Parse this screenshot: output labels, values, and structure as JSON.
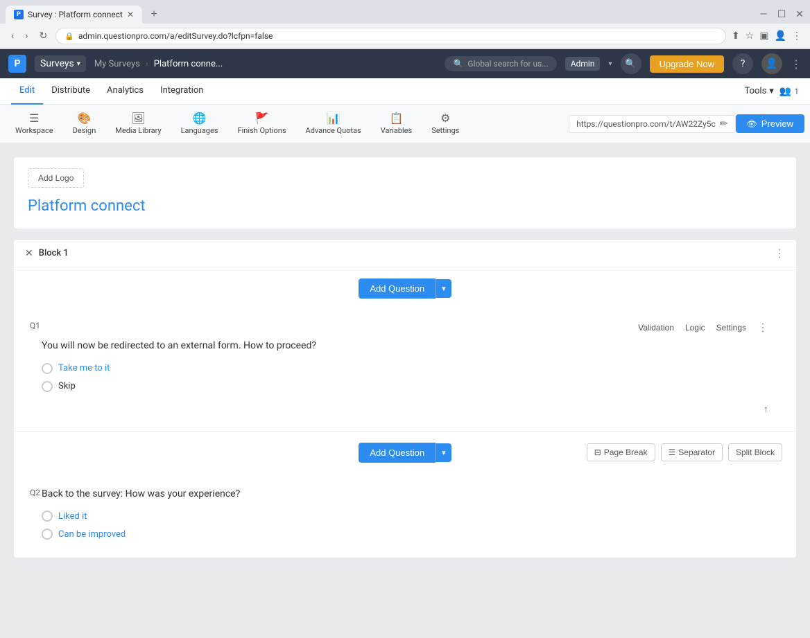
{
  "browser": {
    "tab_title": "Survey : Platform connect",
    "tab_favicon": "P",
    "new_tab_icon": "+",
    "url": "admin.questionpro.com/a/editSurvey.do?lcfpn=false",
    "window_controls": {
      "minimize": "—",
      "maximize": "☐",
      "close": "✕"
    }
  },
  "app_navbar": {
    "logo": "P",
    "surveys_label": "Surveys",
    "breadcrumb": {
      "my_surveys": "My Surveys",
      "separator": "›",
      "current": "Platform conne..."
    },
    "search_placeholder": "Global search for us...",
    "admin_label": "Admin",
    "upgrade_label": "Upgrade Now",
    "help_icon": "?",
    "more_icon": "⋮"
  },
  "edit_navbar": {
    "items": [
      {
        "label": "Edit",
        "active": true
      },
      {
        "label": "Distribute",
        "active": false
      },
      {
        "label": "Analytics",
        "active": false
      },
      {
        "label": "Integration",
        "active": false
      }
    ],
    "tools_label": "Tools",
    "team_count": "1"
  },
  "toolbar": {
    "items": [
      {
        "id": "workspace",
        "icon": "☰",
        "label": "Workspace"
      },
      {
        "id": "design",
        "icon": "🎨",
        "label": "Design"
      },
      {
        "id": "media-library",
        "icon": "🖼",
        "label": "Media Library"
      },
      {
        "id": "languages",
        "icon": "🌐",
        "label": "Languages"
      },
      {
        "id": "finish-options",
        "icon": "🚩",
        "label": "Finish Options"
      },
      {
        "id": "advance-quotas",
        "icon": "📊",
        "label": "Advance Quotas"
      },
      {
        "id": "variables",
        "icon": "📋",
        "label": "Variables"
      },
      {
        "id": "settings",
        "icon": "⚙",
        "label": "Settings"
      }
    ],
    "preview_url": "https://questionpro.com/t/AW22Zy5c",
    "preview_label": "Preview"
  },
  "survey": {
    "add_logo_label": "Add Logo",
    "title": "Platform connect",
    "block_title": "Block 1",
    "add_question_label": "Add Question",
    "questions": [
      {
        "number": "Q1",
        "text": "You will now be redirected to an external form. How to proceed?",
        "options": [
          {
            "text": "Take me to it",
            "colored": true
          },
          {
            "text": "Skip",
            "colored": false
          }
        ],
        "actions": [
          "Validation",
          "Logic",
          "Settings"
        ]
      },
      {
        "number": "Q2",
        "text": "Back to the survey: How was your experience?",
        "options": [
          {
            "text": "Liked it",
            "colored": true
          },
          {
            "text": "Can be improved",
            "colored": true
          }
        ]
      }
    ],
    "page_break_label": "Page Break",
    "separator_label": "Separator",
    "split_block_label": "Split Block"
  }
}
